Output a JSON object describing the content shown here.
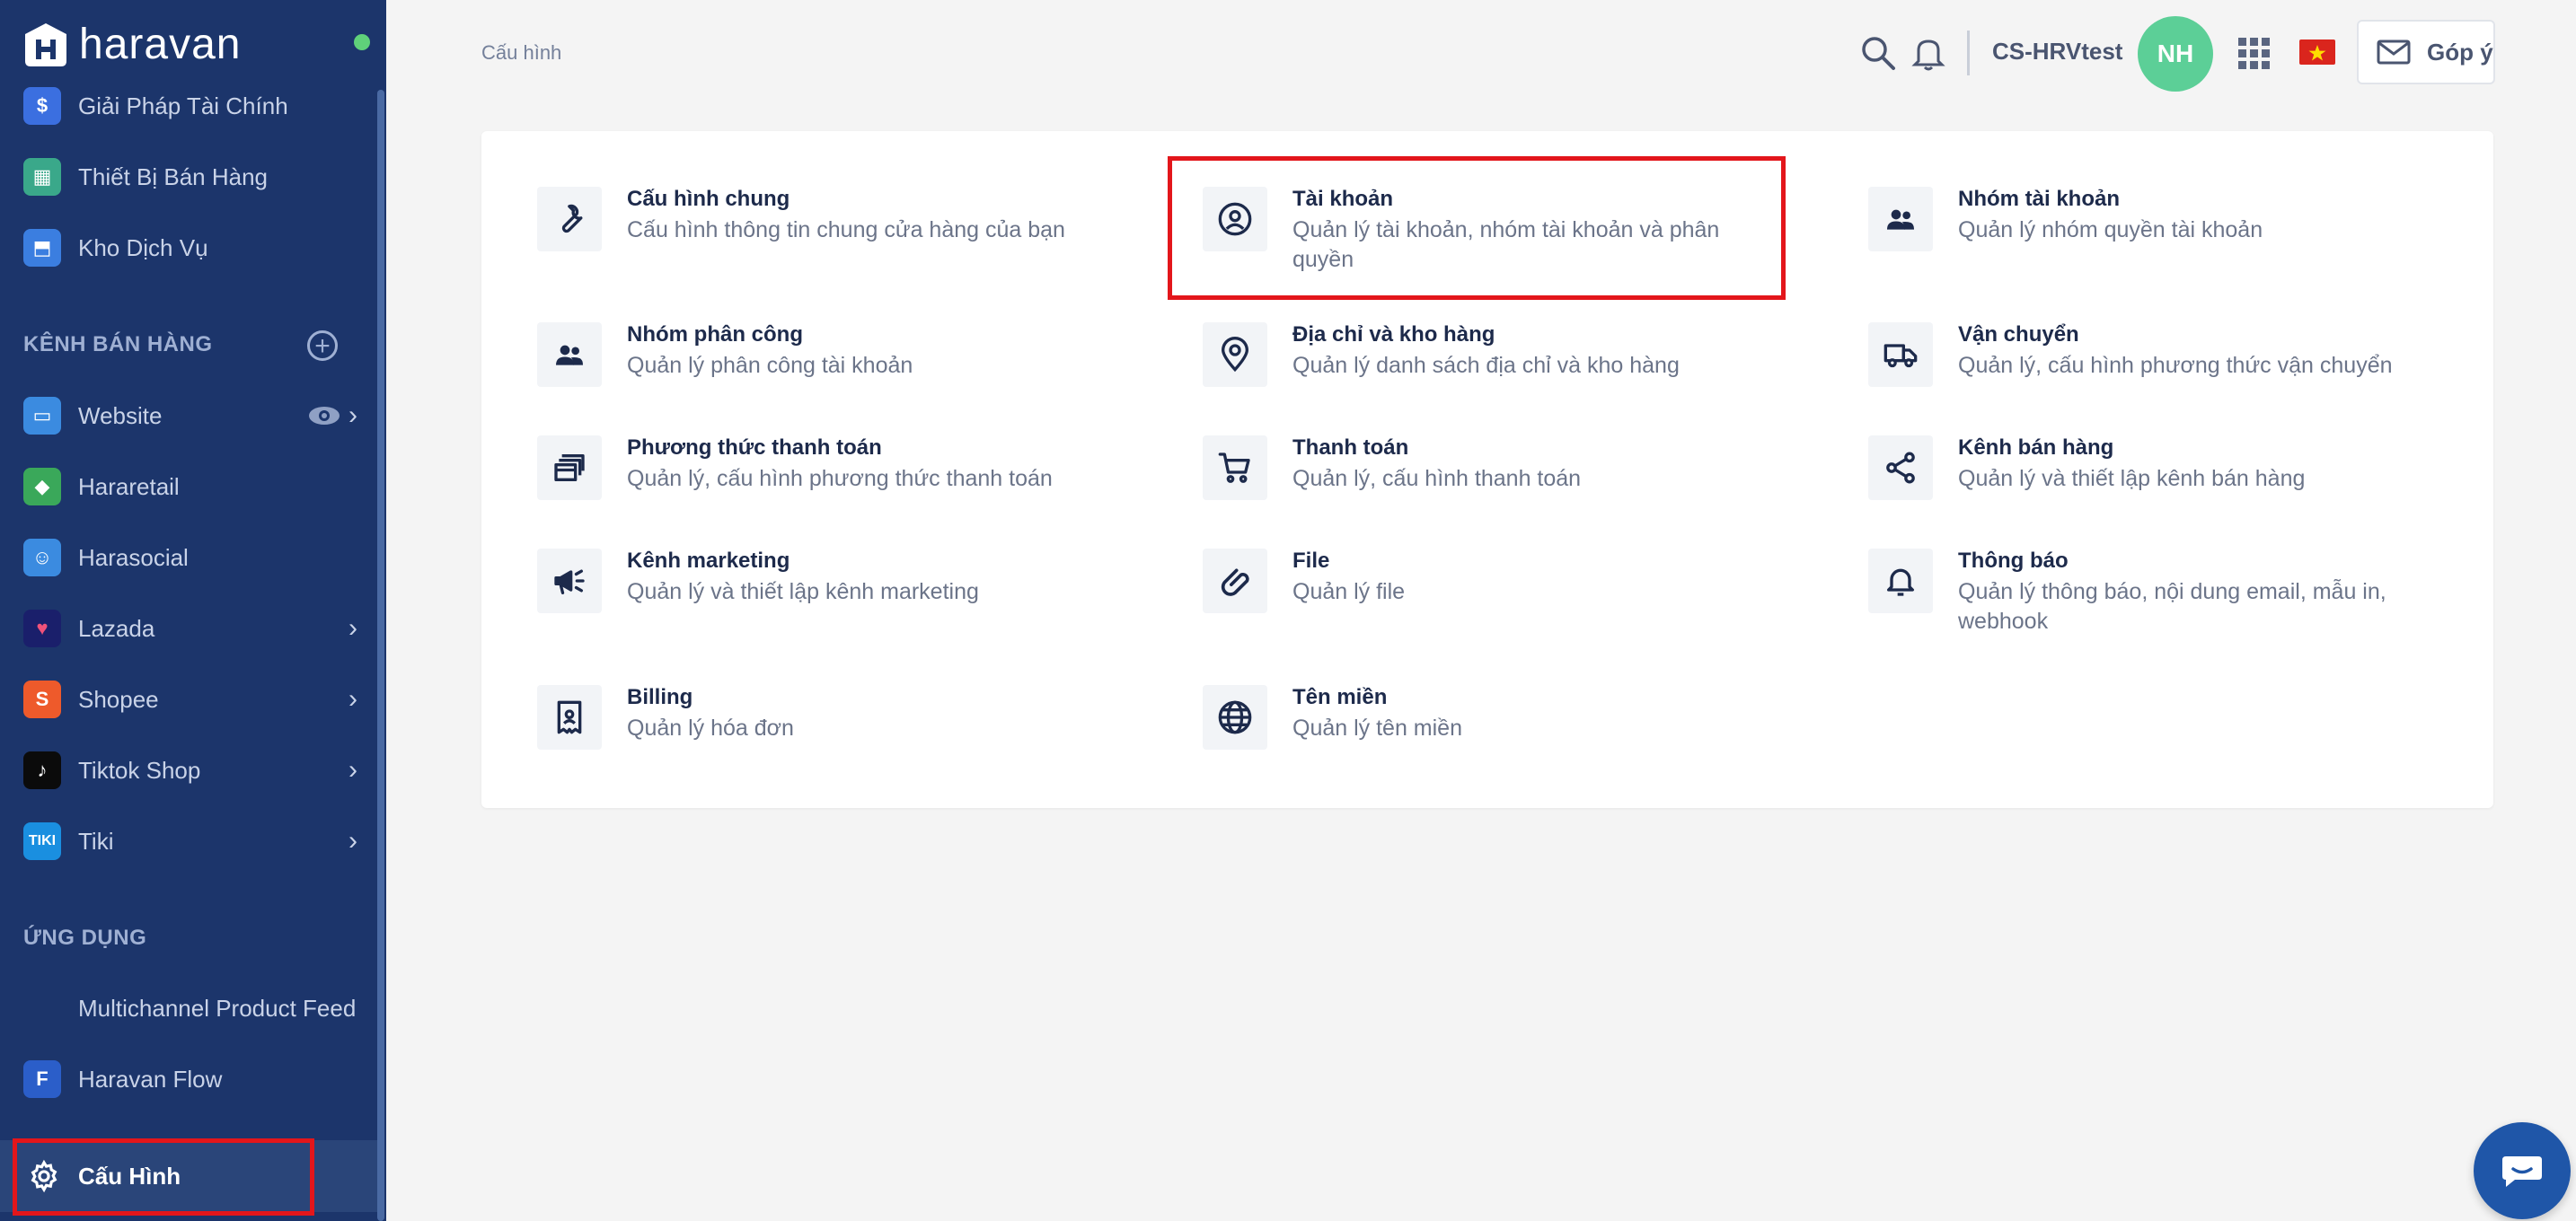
{
  "app": {
    "brand": "haravan",
    "breadcrumb": "Cấu hình"
  },
  "header": {
    "shop_name": "CS-HRVtest",
    "avatar_initials": "NH",
    "feedback_label": "Góp ý",
    "icons": [
      "search-icon",
      "bell-icon",
      "apps-grid-icon",
      "vietnam-flag-icon",
      "mail-icon"
    ]
  },
  "sidebar": {
    "top_items": [
      {
        "label": "Giải Pháp Tài Chính",
        "icon": "finance-icon"
      },
      {
        "label": "Thiết Bị Bán Hàng",
        "icon": "store-device-icon"
      },
      {
        "label": "Kho Dịch Vụ",
        "icon": "service-store-icon"
      }
    ],
    "sales_channels_title": "KÊNH BÁN HÀNG",
    "channels": [
      {
        "label": "Website",
        "icon": "website-icon"
      },
      {
        "label": "Hararetail",
        "icon": "hararetail-icon"
      },
      {
        "label": "Harasocial",
        "icon": "harasocial-icon"
      },
      {
        "label": "Lazada",
        "icon": "lazada-icon"
      },
      {
        "label": "Shopee",
        "icon": "shopee-icon"
      },
      {
        "label": "Tiktok Shop",
        "icon": "tiktok-icon"
      },
      {
        "label": "Tiki",
        "icon": "tiki-icon"
      }
    ],
    "apps_title": "ỨNG DỤNG",
    "apps": [
      {
        "label": "Multichannel Product Feed"
      },
      {
        "label": "Haravan Flow",
        "icon": "haravan-flow-icon"
      }
    ],
    "active_item": {
      "label": "Cấu Hình",
      "icon": "gear-icon"
    }
  },
  "settings": [
    {
      "title": "Cấu hình chung",
      "desc": "Cấu hình thông tin chung cửa hàng của bạn",
      "icon": "wrench-icon"
    },
    {
      "title": "Tài khoản",
      "desc": "Quản lý tài khoản, nhóm tài khoản và phân quyền",
      "icon": "account-circle-icon"
    },
    {
      "title": "Nhóm tài khoản",
      "desc": "Quản lý nhóm quyền tài khoản",
      "icon": "user-group-icon"
    },
    {
      "title": "Nhóm phân công",
      "desc": "Quản lý phân công tài khoản",
      "icon": "team-icon"
    },
    {
      "title": "Địa chỉ và kho hàng",
      "desc": "Quản lý danh sách địa chỉ và kho hàng",
      "icon": "location-pin-icon"
    },
    {
      "title": "Vận chuyển",
      "desc": "Quản lý, cấu hình phương thức vận chuyển",
      "icon": "truck-icon"
    },
    {
      "title": "Phương thức thanh toán",
      "desc": "Quản lý, cấu hình phương thức thanh toán",
      "icon": "payment-card-icon"
    },
    {
      "title": "Thanh toán",
      "desc": "Quản lý, cấu hình thanh toán",
      "icon": "cart-icon"
    },
    {
      "title": "Kênh bán hàng",
      "desc": "Quản lý và thiết lập kênh bán hàng",
      "icon": "share-icon"
    },
    {
      "title": "Kênh marketing",
      "desc": "Quản lý và thiết lập kênh marketing",
      "icon": "megaphone-icon"
    },
    {
      "title": "File",
      "desc": "Quản lý file",
      "icon": "paperclip-icon"
    },
    {
      "title": "Thông báo",
      "desc": "Quản lý thông báo, nội dung email, mẫu in, webhook",
      "icon": "bell-icon"
    },
    {
      "title": "Billing",
      "desc": "Quản lý hóa đơn",
      "icon": "receipt-icon"
    },
    {
      "title": "Tên miền",
      "desc": "Quản lý tên miền",
      "icon": "globe-icon"
    }
  ],
  "colors": {
    "sidebar_bg": "#1c356b",
    "accent_highlight": "#e3161b",
    "avatar_bg": "#5ccf97"
  }
}
